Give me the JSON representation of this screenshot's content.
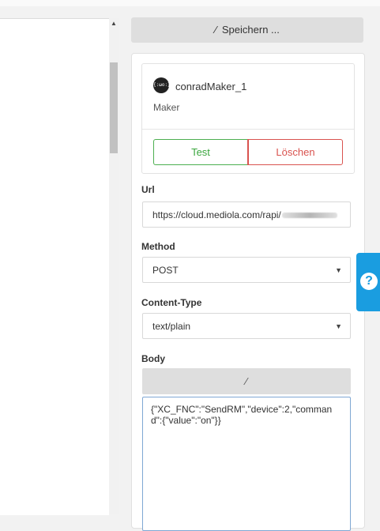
{
  "left_pane": {
    "scroll_up_glyph": "▲"
  },
  "toolbar": {
    "save_icon": "wand-icon",
    "save_label": "Speichern ..."
  },
  "profile": {
    "avatar_text": "{:ωo:}",
    "name": "conradMaker_1",
    "role": "Maker",
    "test_label": "Test",
    "delete_label": "Löschen"
  },
  "form": {
    "url_label": "Url",
    "url_value": "https://cloud.mediola.com/rapi/",
    "method_label": "Method",
    "method_value": "POST",
    "content_type_label": "Content-Type",
    "content_type_value": "text/plain",
    "body_label": "Body",
    "body_wand_icon": "wand-icon",
    "body_value": "{\"XC_FNC\":\"SendRM\",\"device\":2,\"command\":{\"value\":\"on\"}}"
  },
  "help": {
    "label": "?"
  },
  "colors": {
    "test_green": "#3aa63e",
    "delete_red": "#d9534f",
    "help_blue": "#1a9de0",
    "focus_border": "#7fa7d3"
  }
}
